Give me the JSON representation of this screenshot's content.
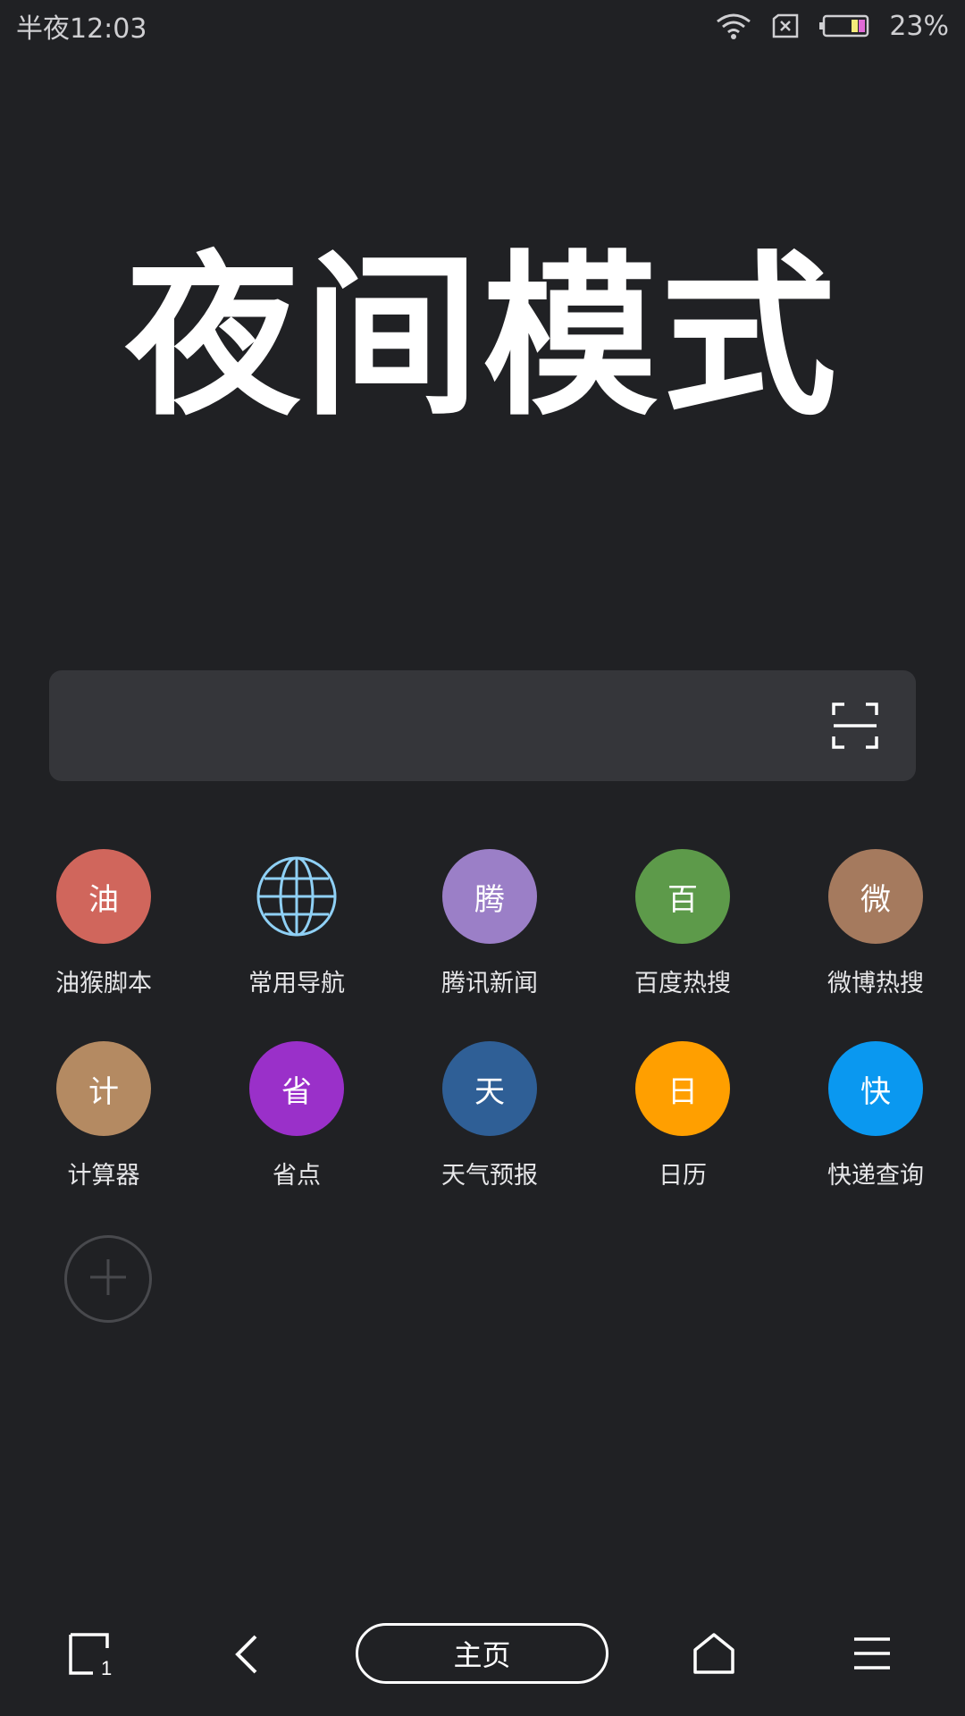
{
  "status_bar": {
    "time": "半夜12:03",
    "battery_percent": "23%",
    "icons": [
      "wifi-icon",
      "no-sim-icon",
      "battery-icon"
    ]
  },
  "hero": {
    "title": "夜间模式"
  },
  "search": {
    "placeholder": "",
    "scan_icon": "scan-icon"
  },
  "shortcuts": [
    {
      "glyph": "油",
      "label": "油猴脚本",
      "color": "#d0665c"
    },
    {
      "glyph": "",
      "label": "常用导航",
      "color": "#8fd0f5",
      "icon": "globe-icon"
    },
    {
      "glyph": "腾",
      "label": "腾讯新闻",
      "color": "#9b7fc7"
    },
    {
      "glyph": "百",
      "label": "百度热搜",
      "color": "#5d9a4a"
    },
    {
      "glyph": "微",
      "label": "微博热搜",
      "color": "#a57a5e"
    },
    {
      "glyph": "计",
      "label": "计算器",
      "color": "#b48a62"
    },
    {
      "glyph": "省",
      "label": "省点",
      "color": "#9a30c9"
    },
    {
      "glyph": "天",
      "label": "天气预报",
      "color": "#2f5f96"
    },
    {
      "glyph": "日",
      "label": "日历",
      "color": "#ff9f00"
    },
    {
      "glyph": "快",
      "label": "快递查询",
      "color": "#0a98f0"
    }
  ],
  "add_shortcut": {
    "icon": "plus-icon"
  },
  "bottom_nav": {
    "tabs_count": "1",
    "home_label": "主页",
    "icons": [
      "tabs-icon",
      "back-icon",
      "home-icon",
      "menu-icon"
    ]
  }
}
